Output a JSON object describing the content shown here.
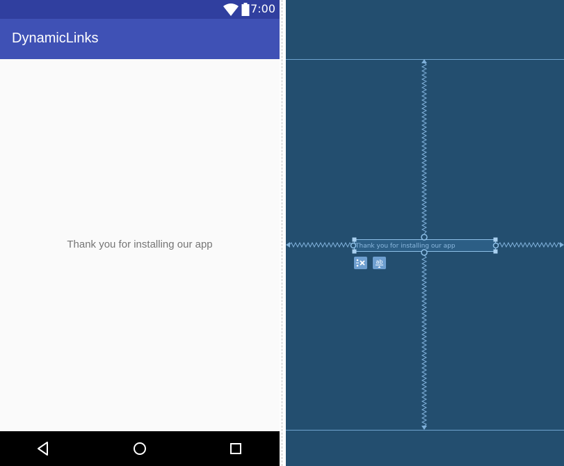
{
  "status_bar": {
    "time": "7:00",
    "icons": [
      "wifi-icon",
      "battery-icon"
    ]
  },
  "app_bar": {
    "title": "DynamicLinks"
  },
  "content": {
    "message": "Thank you for installing our app"
  },
  "nav_bar": {
    "buttons": [
      "back-icon",
      "home-icon",
      "recents-icon"
    ]
  },
  "blueprint": {
    "text": "Thank you for installing our app",
    "tools": [
      "clear-constraints-icon",
      "baseline-icon"
    ],
    "tool_labels": {
      "baseline": "ab"
    }
  },
  "colors": {
    "status_bar": "#303f9f",
    "app_bar": "#3f51b5",
    "content_bg": "#fafafa",
    "nav_bar": "#000000",
    "blueprint_bg": "#234e6f",
    "blueprint_line": "#6fa3cf"
  }
}
